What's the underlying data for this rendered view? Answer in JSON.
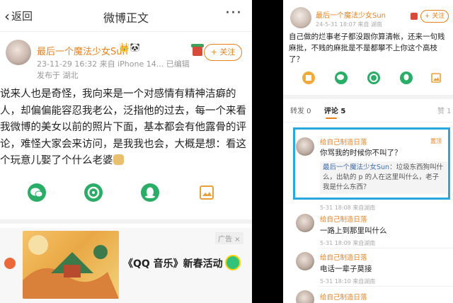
{
  "left": {
    "nav": {
      "back_label": "返回",
      "title": "微博正文",
      "more": "···"
    },
    "post": {
      "username": "最后一个魔法少女Sun",
      "badges": "👑🐼",
      "meta": "23-11-29 16:32  来自 iPhone 14...  已编辑",
      "location": "发布于 湖北",
      "follow_label": "+ 关注",
      "text": "说来人也是奇怪，我向来是一个对感情有精神洁癖的人，却偏偏能容忍我老公，泛指他的过去，每一个来看我微博的美女以前的照片下面，基本都会有他露骨的评论，难怪大家会来访问，是我我也会，大概是想：看这个玩意儿娶了个什么老婆"
    },
    "ad": {
      "tag": "广告 ×",
      "text": "《QQ 音乐》新春活动"
    }
  },
  "right": {
    "post": {
      "username": "最后一个魔法少女Sun",
      "meta": "24-5-31 18:07 来自 湖南",
      "follow_label": "+ 关注",
      "text": "自己做的烂事老子都没跟你算清帐，还来一句贱麻批，不贱的麻批是不是都攀不上你这个高枝了？"
    },
    "tabs": {
      "repost": "转发 0",
      "comment": "评论 5",
      "like": "赞 1"
    },
    "comments": [
      {
        "name": "给自己制造日落",
        "text": "你骂我的时候你不叫了？",
        "time": "5-31 18:08 来自湖南",
        "badge": "置顶"
      },
      {
        "name": "给自己制造日落",
        "text": "一路上到那里叫什么",
        "time": "5-31 18:09 来自湖南"
      },
      {
        "name": "给自己制造日落",
        "text": "电话一辈子莫接",
        "time": "5-31 18:10 来自湖南"
      },
      {
        "name": "给自己制造日落",
        "text": "",
        "time": ""
      }
    ],
    "reply": {
      "name": "最后一个魔法少女Sun",
      "text": "：垃圾东西狗叫什么，出轨的 p 的人在这里叫什么，老子我是什么东西？"
    }
  }
}
